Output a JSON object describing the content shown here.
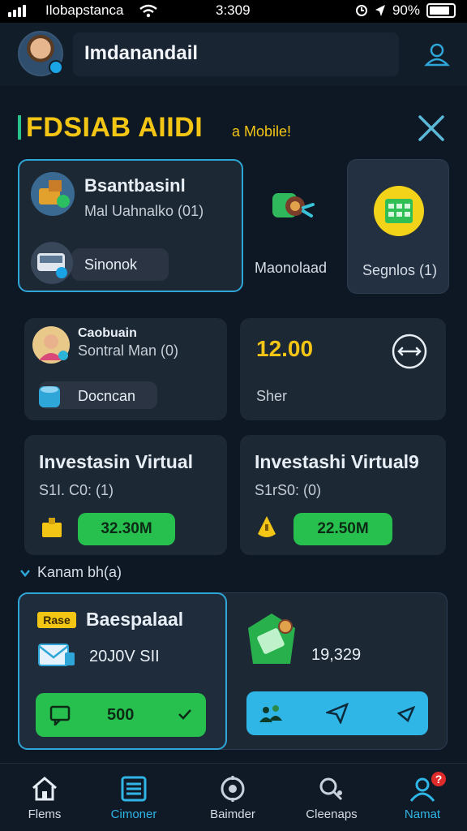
{
  "status_bar": {
    "carrier": "Ilobapstanca",
    "time": "3:309",
    "battery": "90%"
  },
  "header": {
    "title": "Imdanandail"
  },
  "page": {
    "title": "FDSIAB AIIDI",
    "subtitle": "a Mobile!"
  },
  "top_cards": {
    "card1": {
      "title": "Bsantbasinl",
      "subtitle": "Mal Uahnalko (01)",
      "pill_label": "Sinonok"
    },
    "card2": {
      "label": "Maonolaad"
    },
    "card3": {
      "label": "Segnlos (1)"
    }
  },
  "mid_cards": {
    "left": {
      "title": "Caobuain",
      "subtitle": "Sontral Man (0)",
      "pill_label": "Docncan"
    },
    "right": {
      "value": "12.00",
      "label": "Sher"
    }
  },
  "invest_cards": [
    {
      "title": "Investasin Virtual",
      "subtitle": "S1I. C0: (1)",
      "amount": "32.30M"
    },
    {
      "title": "Investashi Virtual9",
      "subtitle": "S1rS0: (0)",
      "amount": "22.50M"
    }
  ],
  "section": {
    "label": "Kanam bh(a)"
  },
  "bottom_card": {
    "title": "Baespalaal",
    "tag": "Rase",
    "detail": "20J0V SII",
    "button_value": "500",
    "value": "19,329"
  },
  "bottom_nav": [
    {
      "label": "Flems"
    },
    {
      "label": "Cimoner"
    },
    {
      "label": "Baimder"
    },
    {
      "label": "Cleenaps"
    },
    {
      "label": "Namat",
      "badge": "?"
    }
  ],
  "colors": {
    "accent": "#2fa6d8",
    "yellow": "#f3c514",
    "green": "#27c04e",
    "background": "#0e1824",
    "card": "#1d2835"
  }
}
